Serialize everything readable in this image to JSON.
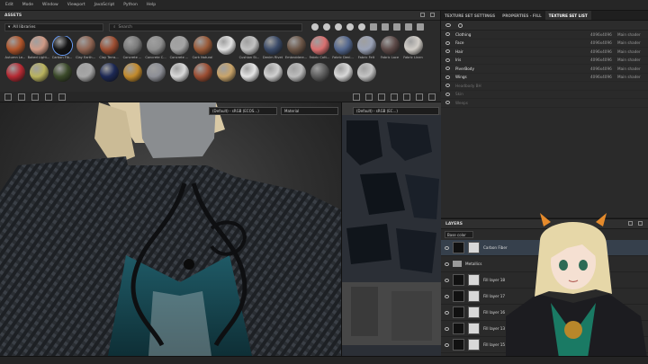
{
  "menu": [
    "Edit",
    "Mode",
    "Window",
    "Viewport",
    "JavaScript",
    "Python",
    "Help"
  ],
  "assets": {
    "title": "ASSETS",
    "library": "All libraries",
    "search_placeholder": "Search",
    "materials": [
      {
        "label": "Autumn Le...",
        "color": "#b0552b"
      },
      {
        "label": "Baked Light...",
        "color": "#cf9a86"
      },
      {
        "label": "Carbon Fib...",
        "color": "#151515"
      },
      {
        "label": "Clay Earth...",
        "color": "#8f6452"
      },
      {
        "label": "Clay Terra...",
        "color": "#9d4e32"
      },
      {
        "label": "Concrete ...",
        "color": "#7a7a7a"
      },
      {
        "label": "Concrete C...",
        "color": "#8f8f8f"
      },
      {
        "label": "Concrete ...",
        "color": "#a4a4a4"
      },
      {
        "label": "Cork Natural",
        "color": "#9a5a38"
      },
      {
        "label": "",
        "color": "#e2e2e2"
      },
      {
        "label": "Cushion St...",
        "color": "#c2c2c2"
      },
      {
        "label": "Denim Rivet",
        "color": "#3a4a68"
      },
      {
        "label": "Embroidere...",
        "color": "#6b5546"
      },
      {
        "label": "Fabric Cott...",
        "color": "#d97070"
      },
      {
        "label": "Fabric Deni...",
        "color": "#53678e"
      },
      {
        "label": "Fabric Felt",
        "color": "#9aa2b6"
      },
      {
        "label": "Fabric Lace",
        "color": "#5d4a48"
      },
      {
        "label": "Fabric Linen",
        "color": "#d2cec8"
      },
      {
        "label": "",
        "color": "#b52a33"
      },
      {
        "label": "",
        "color": "#b9b35e"
      },
      {
        "label": "",
        "color": "#3b4a2a"
      },
      {
        "label": "",
        "color": "#a7a7a7"
      },
      {
        "label": "",
        "color": "#1c2854"
      },
      {
        "label": "",
        "color": "#c28a2c"
      },
      {
        "label": "",
        "color": "#8d8f96"
      },
      {
        "label": "",
        "color": "#d9d9d9"
      },
      {
        "label": "",
        "color": "#9b4d32"
      },
      {
        "label": "",
        "color": "#c9a46a"
      },
      {
        "label": "",
        "color": "#e5e5e5"
      },
      {
        "label": "",
        "color": "#d0d0d0"
      },
      {
        "label": "",
        "color": "#bdbdbd"
      },
      {
        "label": "",
        "color": "#5d5d5d"
      },
      {
        "label": "",
        "color": "#d8d8d8"
      },
      {
        "label": "",
        "color": "#c4c4c4"
      }
    ]
  },
  "viewport": {
    "channel_3d": "(Default) - sRGB (ECOS…)",
    "material_3d": "Material",
    "channel_2d": "(Default) - sRGB (EC...)",
    "material_2d": "Material"
  },
  "texture_sets": {
    "tabs": [
      "TEXTURE SET SETTINGS",
      "PROPERTIES - FILL",
      "TEXTURE SET LIST"
    ],
    "active_tab": 2,
    "rows": [
      {
        "name": "Clothing",
        "res": "4096x4096",
        "shader": "Main shader",
        "dim": false
      },
      {
        "name": "Face",
        "res": "4096x4096",
        "shader": "Main shader",
        "dim": false
      },
      {
        "name": "Hair",
        "res": "4096x4096",
        "shader": "Main shader",
        "dim": false
      },
      {
        "name": "Iris",
        "res": "4096x4096",
        "shader": "Main shader",
        "dim": false
      },
      {
        "name": "PiverBody",
        "res": "4096x4096",
        "shader": "Main shader",
        "dim": false
      },
      {
        "name": "Wings",
        "res": "4096x4096",
        "shader": "Main shader",
        "dim": false
      },
      {
        "name": "Headbody BH",
        "res": "",
        "shader": "",
        "dim": true
      },
      {
        "name": "Skin",
        "res": "",
        "shader": "",
        "dim": true
      },
      {
        "name": "Weeps",
        "res": "",
        "shader": "",
        "dim": true
      }
    ]
  },
  "layers": {
    "title": "LAYERS",
    "blend": "Base color",
    "rows": [
      {
        "name": "Carbon Fiber",
        "kind": "fill",
        "selected": true,
        "blend": "Norm",
        "opacity": "100"
      },
      {
        "name": "Metallics",
        "kind": "folder",
        "selected": false,
        "blend": "",
        "opacity": ""
      },
      {
        "name": "Fill layer 18",
        "kind": "fill",
        "selected": false,
        "blend": "None",
        "opacity": "100"
      },
      {
        "name": "Fill layer 17",
        "kind": "fill",
        "selected": false,
        "blend": "None",
        "opacity": "100"
      },
      {
        "name": "Fill layer 16",
        "kind": "fill",
        "selected": false,
        "blend": "None",
        "opacity": "100"
      },
      {
        "name": "Fill layer 13",
        "kind": "fill",
        "selected": false,
        "blend": "None",
        "opacity": "100"
      },
      {
        "name": "Fill layer 15",
        "kind": "fill",
        "selected": false,
        "blend": "None",
        "opacity": "100"
      }
    ]
  }
}
